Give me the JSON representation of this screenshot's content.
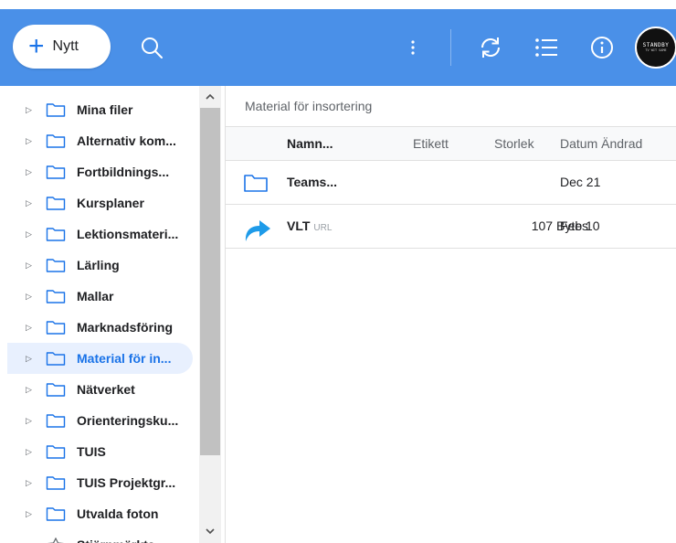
{
  "toolbar": {
    "new_label": "Nytt",
    "avatar_line1": "STANDBY",
    "avatar_line2": "TV WIT SAME"
  },
  "sidebar": {
    "items": [
      {
        "label": "Mina filer"
      },
      {
        "label": "Alternativ kom..."
      },
      {
        "label": "Fortbildnings..."
      },
      {
        "label": "Kursplaner"
      },
      {
        "label": "Lektionsmateri..."
      },
      {
        "label": "Lärling"
      },
      {
        "label": "Mallar"
      },
      {
        "label": "Marknadsföring"
      },
      {
        "label": "Material för in...",
        "selected": true
      },
      {
        "label": "Nätverket"
      },
      {
        "label": "Orienteringsku..."
      },
      {
        "label": "TUIS"
      },
      {
        "label": "TUIS Projektgr..."
      },
      {
        "label": "Utvalda foton"
      },
      {
        "label": "Stjärnmärkta"
      }
    ]
  },
  "main": {
    "breadcrumb": "Material för insortering",
    "columns": {
      "name": "Namn...",
      "tag": "Etikett",
      "size": "Storlek",
      "date": "Datum Ändrad"
    },
    "rows": [
      {
        "icon": "folder-icon",
        "name": "Teams...",
        "badge": "",
        "size": "",
        "date": "Dec 21"
      },
      {
        "icon": "shortcut-arrow-icon",
        "name": "VLT",
        "badge": "URL",
        "size": "107 Bytes",
        "date": "Feb 10"
      }
    ]
  },
  "colors": {
    "topbar": "#4a90e8",
    "accent": "#1a73e8",
    "selected_bg": "#e8f0fe",
    "link_icon": "#1e9be9"
  }
}
